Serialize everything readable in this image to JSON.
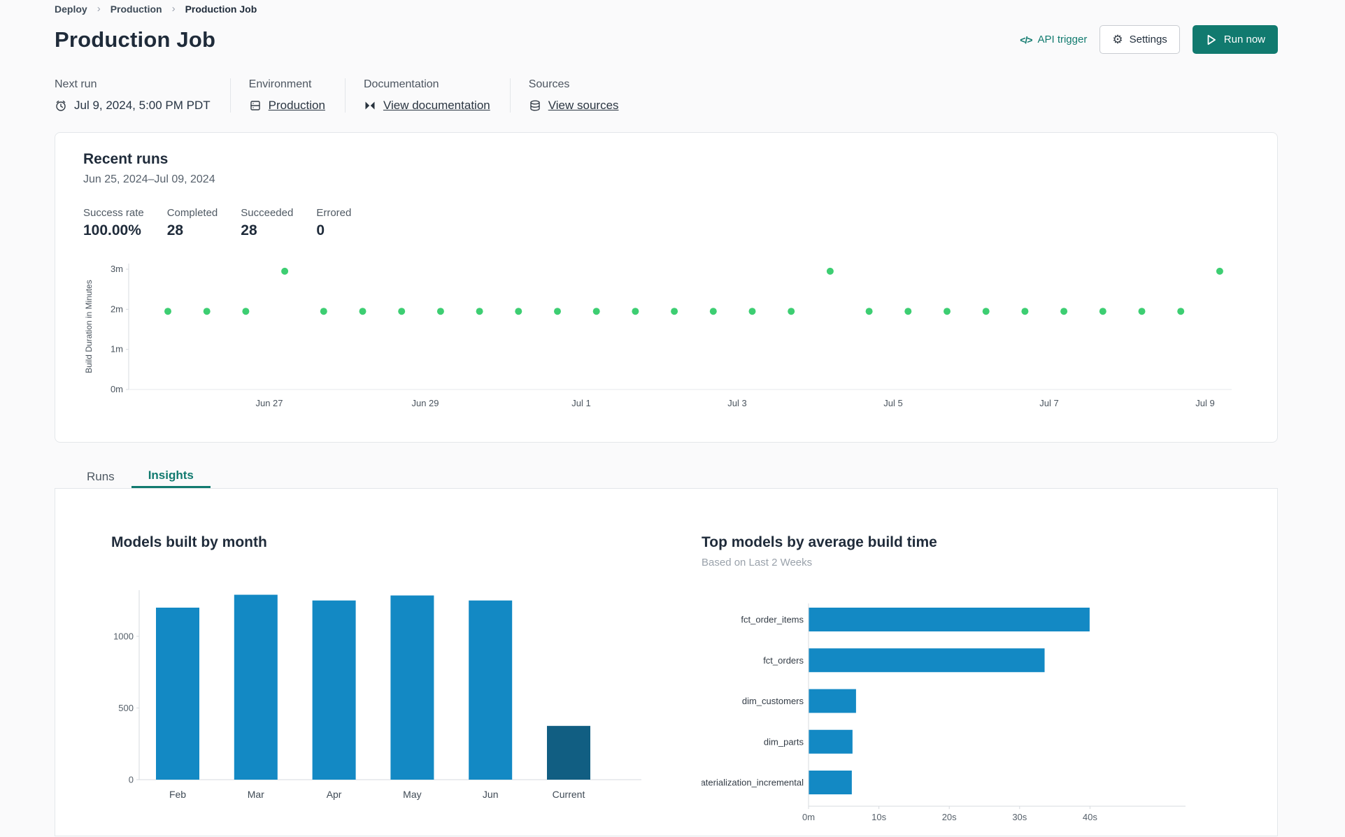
{
  "breadcrumb": {
    "separator": "›",
    "items": [
      "Deploy",
      "Production",
      "Production Job"
    ]
  },
  "header": {
    "title": "Production Job",
    "api_trigger_label": "API trigger",
    "api_trigger_glyph": "</>",
    "settings_label": "Settings",
    "settings_glyph": "⚙",
    "run_now_label": "Run now"
  },
  "info_bar": {
    "next_run": {
      "label": "Next run",
      "value": "Jul 9, 2024, 5:00 PM PDT"
    },
    "environment": {
      "label": "Environment",
      "value": "Production"
    },
    "documentation": {
      "label": "Documentation",
      "value": "View documentation"
    },
    "sources": {
      "label": "Sources",
      "value": "View sources"
    }
  },
  "recent_runs": {
    "title": "Recent runs",
    "date_range": "Jun 25, 2024–Jul 09, 2024",
    "stats": [
      {
        "label": "Success rate",
        "value": "100.00%"
      },
      {
        "label": "Completed",
        "value": "28"
      },
      {
        "label": "Succeeded",
        "value": "28"
      },
      {
        "label": "Errored",
        "value": "0"
      }
    ]
  },
  "tabs": [
    {
      "label": "Runs",
      "active": false
    },
    {
      "label": "Insights",
      "active": true
    }
  ],
  "colors": {
    "accent_teal": "#117a6f",
    "dot_green": "#3dce72",
    "bar_blue": "#1389c4",
    "bar_dark_blue": "#115e82",
    "axis_line": "#d7dbdf",
    "axis_text": "#4a545e"
  },
  "chart_data": [
    {
      "id": "build-duration-scatter",
      "type": "scatter",
      "ylabel": "Build Duration in Minutes",
      "y_ticks": [
        0,
        1,
        2,
        3
      ],
      "y_tick_suffix": "m",
      "ylim": [
        0,
        3.2
      ],
      "x_tick_labels": [
        "Jun 27",
        "Jun 29",
        "Jul 1",
        "Jul 3",
        "Jul 5",
        "Jul 7",
        "Jul 9"
      ],
      "point_color": "#3dce72",
      "minutes": [
        1.95,
        1.95,
        1.95,
        2.95,
        1.95,
        1.95,
        1.95,
        1.95,
        1.95,
        1.95,
        1.95,
        1.95,
        1.95,
        1.95,
        1.95,
        1.95,
        1.95,
        2.95,
        1.95,
        1.95,
        1.95,
        1.95,
        1.95,
        1.95,
        1.95,
        1.95,
        1.95,
        2.95
      ]
    },
    {
      "id": "models-built-by-month",
      "type": "bar",
      "title": "Models built by month",
      "categories": [
        "Feb",
        "Mar",
        "Apr",
        "May",
        "Jun",
        "Current"
      ],
      "values": [
        1200,
        1290,
        1250,
        1285,
        1250,
        375
      ],
      "bar_colors": [
        "#1389c4",
        "#1389c4",
        "#1389c4",
        "#1389c4",
        "#1389c4",
        "#115e82"
      ],
      "y_ticks": [
        0,
        500,
        1000
      ],
      "ylim": [
        0,
        1350
      ],
      "grid": false
    },
    {
      "id": "top-models-by-build-time",
      "type": "bar-horizontal",
      "title": "Top models by average build time",
      "subtitle": "Based on Last 2 Weeks",
      "categories": [
        "fct_order_items",
        "fct_orders",
        "dim_customers",
        "dim_parts",
        "materialization_incremental"
      ],
      "values_seconds": [
        39.9,
        33.5,
        6.7,
        6.2,
        6.1
      ],
      "bar_color": "#1389c4",
      "x_ticks": [
        {
          "v": 0,
          "label": "0m"
        },
        {
          "v": 10,
          "label": "10s"
        },
        {
          "v": 20,
          "label": "20s"
        },
        {
          "v": 30,
          "label": "30s"
        },
        {
          "v": 40,
          "label": "40s"
        }
      ],
      "xlim": [
        0,
        44
      ],
      "grid": false
    }
  ]
}
